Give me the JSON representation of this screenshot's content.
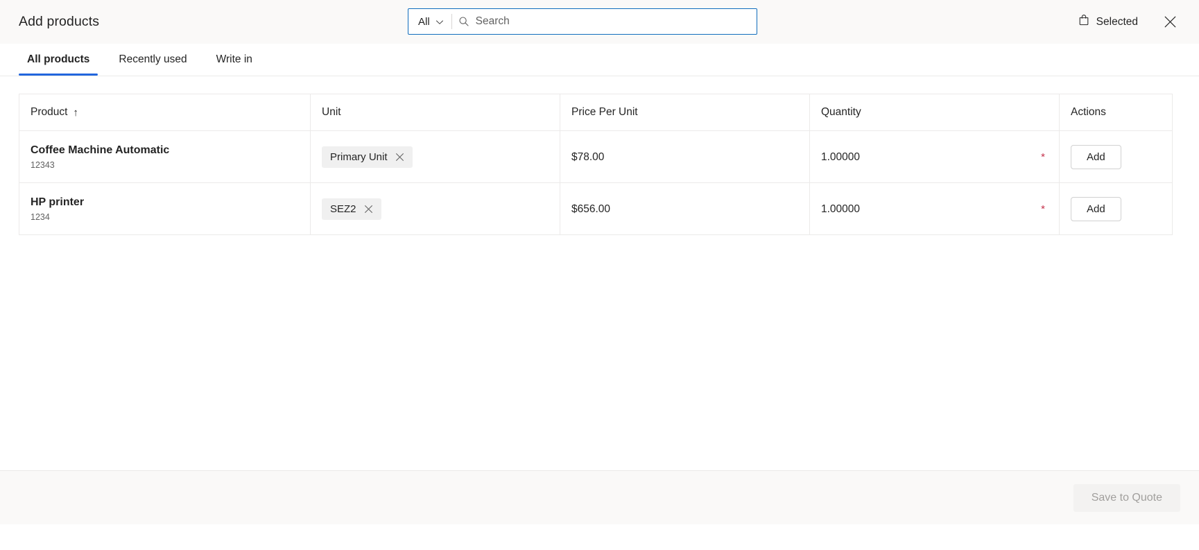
{
  "header": {
    "title": "Add products",
    "search": {
      "scope_label": "All",
      "scope_icon": "chevron-down-icon",
      "icon": "search-icon",
      "placeholder": "Search",
      "value": ""
    },
    "selected": {
      "label": "Selected",
      "icon": "shopping-bag-icon"
    },
    "close_icon": "close-icon"
  },
  "tabs": [
    {
      "label": "All products",
      "active": true
    },
    {
      "label": "Recently used",
      "active": false
    },
    {
      "label": "Write in",
      "active": false
    }
  ],
  "table": {
    "columns": [
      {
        "label": "Product",
        "sort": "↑"
      },
      {
        "label": "Unit",
        "sort": ""
      },
      {
        "label": "Price Per Unit",
        "sort": ""
      },
      {
        "label": "Quantity",
        "sort": ""
      },
      {
        "label": "Actions",
        "sort": ""
      }
    ],
    "rows": [
      {
        "product_name": "Coffee Machine Automatic",
        "product_id": "12343",
        "unit_chip": "Primary Unit",
        "unit_chip_dismiss_icon": "close-icon",
        "price": "$78.00",
        "quantity": "1.00000",
        "quantity_required": "*",
        "action_label": "Add"
      },
      {
        "product_name": "HP printer",
        "product_id": "1234",
        "unit_chip": "SEZ2",
        "unit_chip_dismiss_icon": "close-icon",
        "price": "$656.00",
        "quantity": "1.00000",
        "quantity_required": "*",
        "action_label": "Add"
      }
    ]
  },
  "footer": {
    "save_label": "Save to Quote",
    "save_disabled": true
  },
  "colors": {
    "accent": "#2266dd",
    "header_bg": "#faf9f8",
    "border": "#ebeae9",
    "required": "#c4314b",
    "text": "#242424",
    "muted": "#616161"
  }
}
